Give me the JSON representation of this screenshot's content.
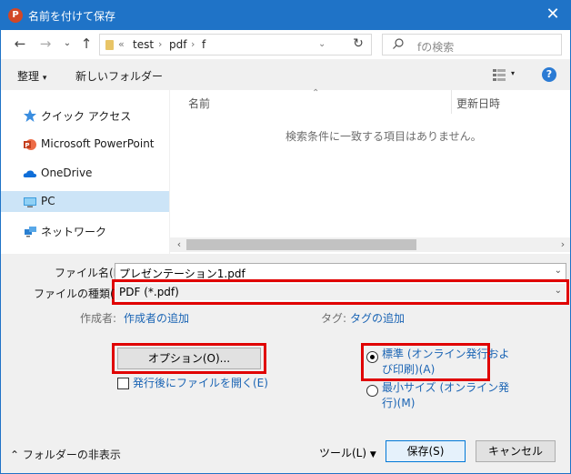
{
  "window": {
    "title": "名前を付けて保存",
    "app_icon_letter": "P"
  },
  "address_bar": {
    "segments": [
      "test",
      "pdf",
      "f"
    ],
    "overflow": "«"
  },
  "search": {
    "placeholder": "fの検索"
  },
  "toolbar": {
    "organize": "整理",
    "new_folder": "新しいフォルダー"
  },
  "nav_pane": {
    "items": [
      {
        "label": "クイック アクセス",
        "icon": "star-icon"
      },
      {
        "label": "Microsoft PowerPoint",
        "icon": "powerpoint-icon"
      },
      {
        "label": "OneDrive",
        "icon": "cloud-icon"
      },
      {
        "label": "PC",
        "icon": "computer-icon",
        "selected": true
      },
      {
        "label": "ネットワーク",
        "icon": "network-icon"
      }
    ]
  },
  "file_list": {
    "columns": {
      "name": "名前",
      "date": "更新日時"
    },
    "empty_message": "検索条件に一致する項目はありません。"
  },
  "form": {
    "filename_label": "ファイル名(N):",
    "filename_value": "プレゼンテーション1.pdf",
    "filetype_label": "ファイルの種類(T):",
    "filetype_value": "PDF (*.pdf)",
    "author_label": "作成者:",
    "author_link": "作成者の追加",
    "tags_label": "タグ:",
    "tags_link": "タグの追加"
  },
  "options": {
    "button_label": "オプション(O)...",
    "open_after_label": "発行後にファイルを開く(E)",
    "open_after_checked": false,
    "optimize_standard_line1": "標準 (オンライン発行およ",
    "optimize_standard_line2": "び印刷)(A)",
    "optimize_min_line1": "最小サイズ (オンライン発",
    "optimize_min_line2": "行)(M)",
    "selected": "standard"
  },
  "footer": {
    "hide_folders": "フォルダーの非表示",
    "tools": "ツール(L)",
    "save": "保存(S)",
    "cancel": "キャンセル"
  },
  "colors": {
    "titlebar": "#1f73c7",
    "highlight": "#e00000",
    "link": "#1a64b4",
    "selection": "#cce4f7"
  }
}
